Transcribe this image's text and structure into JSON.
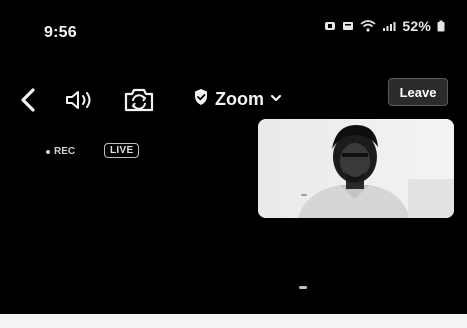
{
  "status_bar": {
    "time": "9:56",
    "battery": "52%",
    "icons": [
      "notification-icon",
      "message-icon",
      "wifi-icon",
      "signal-icon",
      "battery-icon"
    ]
  },
  "toolbar": {
    "back_icon": "chevron-left-icon",
    "speaker_icon": "speaker-icon",
    "camera_icon": "camera-flip-icon",
    "meeting_title": "Zoom",
    "title_icon": "shield-check-icon",
    "dropdown_icon": "chevron-down-icon",
    "leave_label": "Leave"
  },
  "indicators": {
    "rec_label": "REC",
    "live_label": "LIVE"
  },
  "video": {
    "participant_avatar": "participant-video"
  },
  "colors": {
    "background": "#000000",
    "foreground": "#f2f2f2",
    "leave_button_bg": "#2b2b2b"
  }
}
